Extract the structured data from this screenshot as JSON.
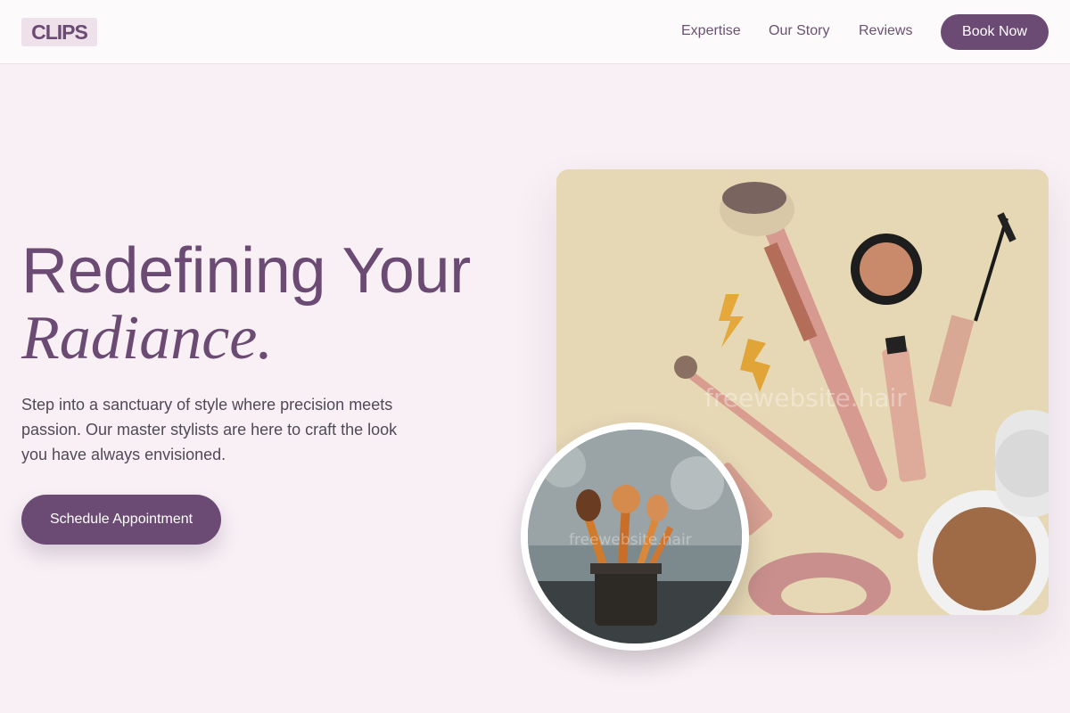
{
  "header": {
    "logo": "CLIPS",
    "nav": [
      "Expertise",
      "Our Story",
      "Reviews"
    ],
    "cta_label": "Book Now"
  },
  "hero": {
    "title_line1": "Redefining Your",
    "title_line2": "Radiance.",
    "description": "Step into a sanctuary of style where precision meets passion. Our master stylists are here to craft the look you have always envisioned.",
    "cta_label": "Schedule Appointment"
  },
  "images": {
    "main_watermark": "freewebsite.hair",
    "circle_watermark": "freewebsite.hair"
  },
  "colors": {
    "primary": "#6b4a73",
    "background": "#f8f0f5",
    "header_bg": "#fdfafc",
    "text_body": "#4f4a57"
  }
}
